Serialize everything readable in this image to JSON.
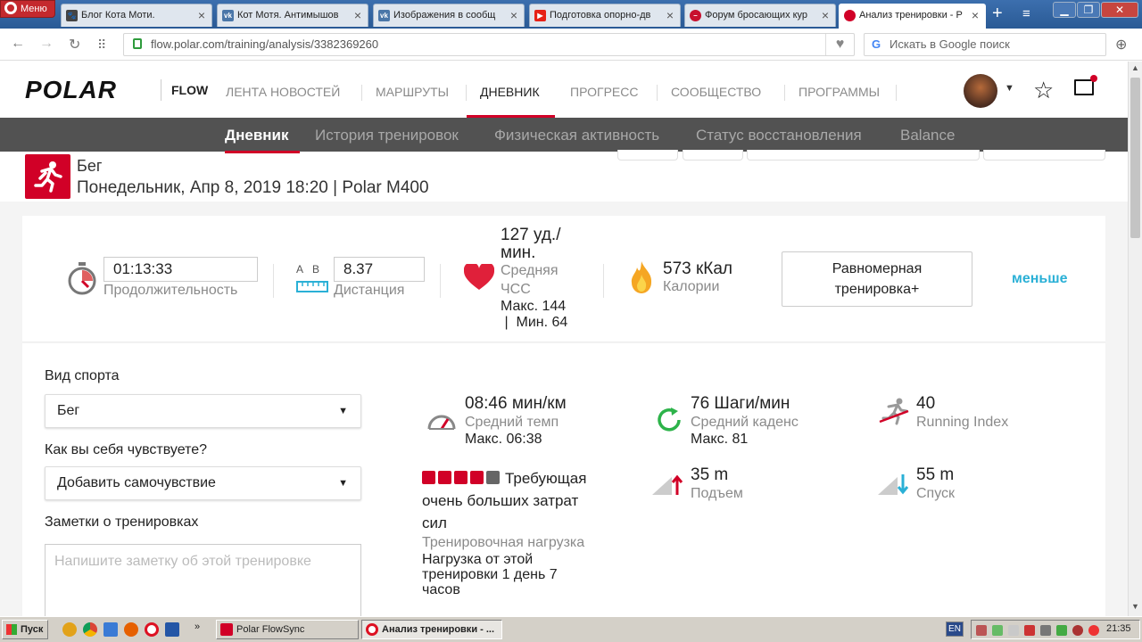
{
  "browser": {
    "menu_label": "Меню",
    "tabs": [
      {
        "title": "Блог Кота Моти.",
        "icon": "cat-icon"
      },
      {
        "title": "Кот Мотя. Антимышов",
        "icon": "vk-icon"
      },
      {
        "title": "Изображения в сообщ",
        "icon": "vk-icon"
      },
      {
        "title": "Подготовка опорно-дв",
        "icon": "youtube-icon"
      },
      {
        "title": "Форум бросающих кур",
        "icon": "forum-icon"
      },
      {
        "title": "Анализ тренировки - Р",
        "icon": "polar-icon"
      }
    ],
    "url": "flow.polar.com/training/analysis/3382369260",
    "search_placeholder": "Искать в Google поиск"
  },
  "header": {
    "logo": "POLAR",
    "product": "FLOW",
    "nav": [
      {
        "label": "ЛЕНТА НОВОСТЕЙ"
      },
      {
        "label": "МАРШРУТЫ"
      },
      {
        "label": "ДНЕВНИК",
        "active": true
      },
      {
        "label": "ПРОГРЕСС"
      },
      {
        "label": "СООБЩЕСТВО"
      },
      {
        "label": "ПРОГРАММЫ"
      }
    ]
  },
  "subnav": [
    {
      "label": "Дневник",
      "active": true
    },
    {
      "label": "История тренировок"
    },
    {
      "label": "Физическая активность"
    },
    {
      "label": "Статус восстановления"
    },
    {
      "label": "Balance"
    }
  ],
  "training": {
    "sport": "Бег",
    "subtitle": "Понедельник, Апр 8, 2019 18:20 | Polar M400"
  },
  "summary": {
    "duration": {
      "value": "01:13:33",
      "label": "Продолжительность"
    },
    "distance": {
      "from": "A",
      "to": "B",
      "value": "8.37",
      "label": "Дистанция"
    },
    "hr": {
      "value_line1": "127 уд./",
      "value_line2": "мин.",
      "label_line1": "Средняя",
      "label_line2": "ЧСС",
      "max": "Макс. 144",
      "min": " |  Мин. 64"
    },
    "calories": {
      "value": "573 кКал",
      "label": "Калории"
    },
    "benefit_line1": "Равномерная",
    "benefit_line2": "тренировка+",
    "less_label": "меньше"
  },
  "form": {
    "sport_label": "Вид спорта",
    "sport_value": "Бег",
    "feeling_label": "Как вы себя чувствуете?",
    "feeling_value": "Добавить самочувствие",
    "notes_label": "Заметки о тренировках",
    "notes_placeholder": "Напишите заметку об этой тренировке"
  },
  "stats": {
    "pace": {
      "value": "08:46 мин/км",
      "label": "Средний темп",
      "max": "Макс. 06:38"
    },
    "cadence": {
      "value": "76 Шаги/мин",
      "label": "Средний каденс",
      "max": "Макс. 81"
    },
    "running_index": {
      "value": "40",
      "label": "Running Index"
    },
    "load": {
      "level": 4,
      "of": 5,
      "desc_line1": "Требующая",
      "desc_line2": "очень больших затрат",
      "desc_line3": "сил",
      "label": "Тренировочная нагрузка",
      "recovery_line1": "Нагрузка от этой",
      "recovery_line2": "тренировки 1 день 7",
      "recovery_line3": "часов"
    },
    "ascent": {
      "value": "35 m",
      "label": "Подъем"
    },
    "descent": {
      "value": "55 m",
      "label": "Спуск"
    }
  },
  "taskbar": {
    "start": "Пуск",
    "windows": [
      {
        "title": "Polar FlowSync"
      },
      {
        "title": "Анализ тренировки - ...",
        "active": true
      }
    ],
    "lang": "EN",
    "clock": "21:35"
  },
  "colors": {
    "brand_red": "#d10027",
    "link_blue": "#2ab0d6",
    "subnav_bg": "#525252"
  }
}
